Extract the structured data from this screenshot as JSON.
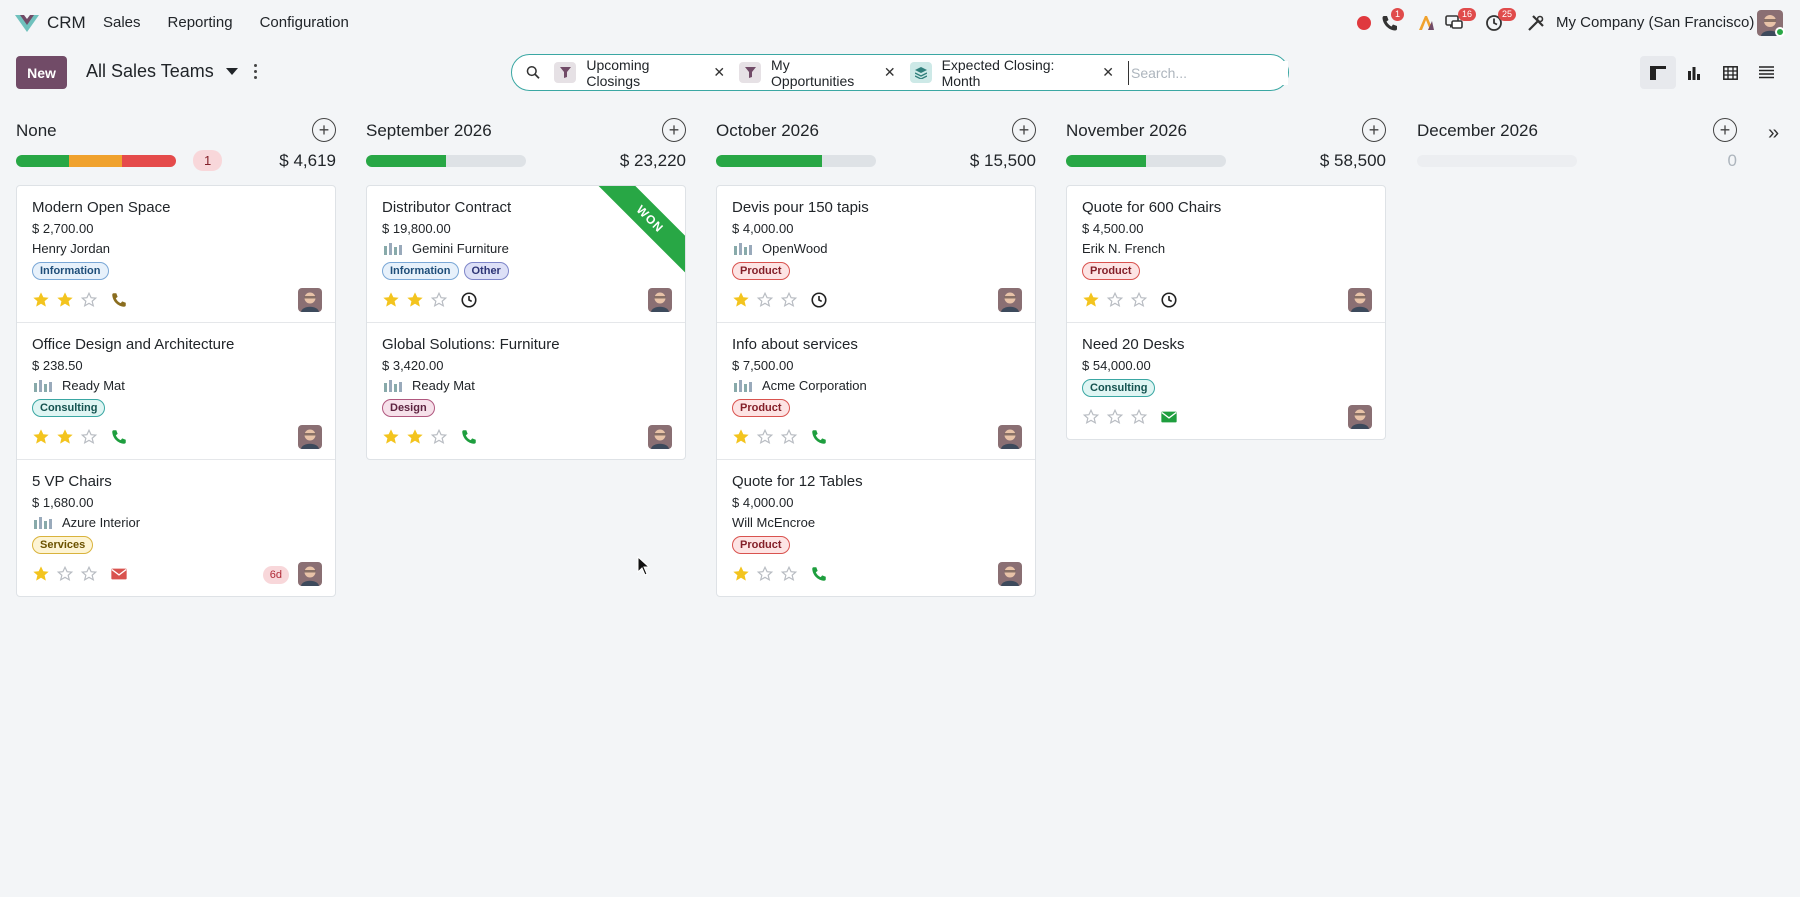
{
  "navbar": {
    "app_name": "CRM",
    "menu": [
      "Sales",
      "Reporting",
      "Configuration"
    ],
    "badges": {
      "calls": "1",
      "messages": "16",
      "activities": "25"
    },
    "company": "My Company (San Francisco)"
  },
  "control": {
    "new_label": "New",
    "breadcrumb": "All Sales Teams",
    "facets": [
      {
        "icon": "filter-icon",
        "label": "Upcoming Closings"
      },
      {
        "icon": "filter-icon",
        "label": "My Opportunities"
      },
      {
        "icon": "group-by-icon",
        "label": "Expected Closing: Month"
      }
    ],
    "search_placeholder": "Search..."
  },
  "colors": {
    "accent": "#714b67",
    "success": "#28a745",
    "warning": "#f0a22e",
    "danger": "#e54b4b",
    "teal": "#3aa7a3"
  },
  "columns": [
    {
      "title": "None",
      "count_badge": "1",
      "total": "$ 4,619",
      "progress": [
        {
          "color": "#28a745",
          "frac": 0.33
        },
        {
          "color": "#f0a22e",
          "frac": 0.33
        },
        {
          "color": "#e54b4b",
          "frac": 0.34
        }
      ],
      "cards": [
        {
          "name": "Modern Open Space",
          "revenue": "$ 2,700.00",
          "partner": "Henry Jordan",
          "partner_logo": false,
          "tags": [
            {
              "label": "Information",
              "kind": "info"
            }
          ],
          "stars": 2,
          "activity": "phone-icon",
          "activity_color": "#8a6d1f"
        },
        {
          "name": "Office Design and Architecture",
          "revenue": "$ 238.50",
          "partner": "Ready Mat",
          "partner_logo": true,
          "tags": [
            {
              "label": "Consulting",
              "kind": "teal"
            }
          ],
          "stars": 2,
          "activity": "phone-icon",
          "activity_color": "#1e9e3e"
        },
        {
          "name": "5 VP Chairs",
          "revenue": "$ 1,680.00",
          "partner": "Azure Interior",
          "partner_logo": true,
          "tags": [
            {
              "label": "Services",
              "kind": "yellow"
            }
          ],
          "stars": 1,
          "activity": "mail-icon",
          "activity_color": "#d9534f",
          "overdue": "6d"
        }
      ]
    },
    {
      "title": "September 2026",
      "total": "$ 23,220",
      "progress": [
        {
          "color": "#28a745",
          "frac": 0.5
        }
      ],
      "cards": [
        {
          "name": "Distributor Contract",
          "revenue": "$ 19,800.00",
          "partner": "Gemini Furniture",
          "partner_logo": true,
          "tags": [
            {
              "label": "Information",
              "kind": "info"
            },
            {
              "label": "Other",
              "kind": "purple"
            }
          ],
          "stars": 2,
          "activity": "clock-icon",
          "activity_color": "#222",
          "ribbon": "WON"
        },
        {
          "name": "Global Solutions: Furniture",
          "revenue": "$ 3,420.00",
          "partner": "Ready Mat",
          "partner_logo": true,
          "tags": [
            {
              "label": "Design",
              "kind": "pink"
            }
          ],
          "stars": 2,
          "activity": "phone-icon",
          "activity_color": "#1e9e3e"
        }
      ]
    },
    {
      "title": "October 2026",
      "total": "$ 15,500",
      "progress": [
        {
          "color": "#28a745",
          "frac": 0.66
        }
      ],
      "cards": [
        {
          "name": "Devis pour 150 tapis",
          "revenue": "$ 4,000.00",
          "partner": "OpenWood",
          "partner_logo": true,
          "tags": [
            {
              "label": "Product",
              "kind": "red"
            }
          ],
          "stars": 1,
          "activity": "clock-icon",
          "activity_color": "#222"
        },
        {
          "name": "Info about services",
          "revenue": "$ 7,500.00",
          "partner": "Acme Corporation",
          "partner_logo": true,
          "tags": [
            {
              "label": "Product",
              "kind": "red"
            }
          ],
          "stars": 1,
          "activity": "phone-icon",
          "activity_color": "#1e9e3e"
        },
        {
          "name": "Quote for 12 Tables",
          "revenue": "$ 4,000.00",
          "partner": "Will McEncroe",
          "partner_logo": false,
          "tags": [
            {
              "label": "Product",
              "kind": "red"
            }
          ],
          "stars": 1,
          "activity": "phone-icon",
          "activity_color": "#1e9e3e"
        }
      ]
    },
    {
      "title": "November 2026",
      "total": "$ 58,500",
      "progress": [
        {
          "color": "#28a745",
          "frac": 0.5
        }
      ],
      "cards": [
        {
          "name": "Quote for 600 Chairs",
          "revenue": "$ 4,500.00",
          "partner": "Erik N. French",
          "partner_logo": false,
          "tags": [
            {
              "label": "Product",
              "kind": "red"
            }
          ],
          "stars": 1,
          "activity": "clock-icon",
          "activity_color": "#222"
        },
        {
          "name": "Need 20 Desks",
          "revenue": "$ 54,000.00",
          "partner": "",
          "partner_logo": false,
          "tags": [
            {
              "label": "Consulting",
              "kind": "teal"
            }
          ],
          "stars": 0,
          "activity": "mail-icon",
          "activity_color": "#1e9e3e"
        }
      ]
    },
    {
      "title": "December 2026",
      "total": "0",
      "muted": true,
      "progress": [],
      "cards": []
    }
  ]
}
